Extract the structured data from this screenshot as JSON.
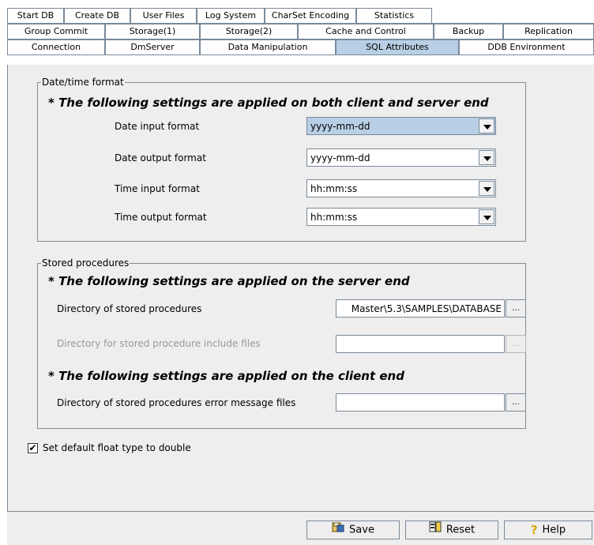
{
  "tabs": {
    "row1": [
      "Start DB",
      "Create DB",
      "User Files",
      "Log System",
      "CharSet Encoding",
      "Statistics"
    ],
    "row2": [
      "Group Commit",
      "Storage(1)",
      "Storage(2)",
      "Cache and Control",
      "Backup",
      "Replication"
    ],
    "row3": [
      "Connection",
      "DmServer",
      "Data Manipulation",
      "SQL Attributes",
      "DDB Environment"
    ],
    "selected": "SQL Attributes"
  },
  "datetime": {
    "legend": "Date/time format",
    "note": "* The following settings are applied on both client and server end",
    "rows": [
      {
        "label": "Date input format",
        "value": "yyyy-mm-dd"
      },
      {
        "label": "Date output format",
        "value": "yyyy-mm-dd"
      },
      {
        "label": "Time input format",
        "value": "hh:mm:ss"
      },
      {
        "label": "Time output format",
        "value": "hh:mm:ss"
      }
    ]
  },
  "stored": {
    "legend": "Stored procedures",
    "server_note": "* The following settings are applied on the server end",
    "client_note": "* The following settings are applied on the client end",
    "dir_label": "Directory of stored procedures",
    "dir_value": "Master\\5.3\\SAMPLES\\DATABASE",
    "include_label": "Directory for stored procedure include files",
    "include_value": "",
    "error_label": "Directory of stored procedures error message files",
    "error_value": "",
    "browse_label": "..."
  },
  "float_checkbox": {
    "label": "Set default float type to double",
    "checked": true
  },
  "buttons": {
    "save": "Save",
    "reset": "Reset",
    "help": "Help"
  }
}
